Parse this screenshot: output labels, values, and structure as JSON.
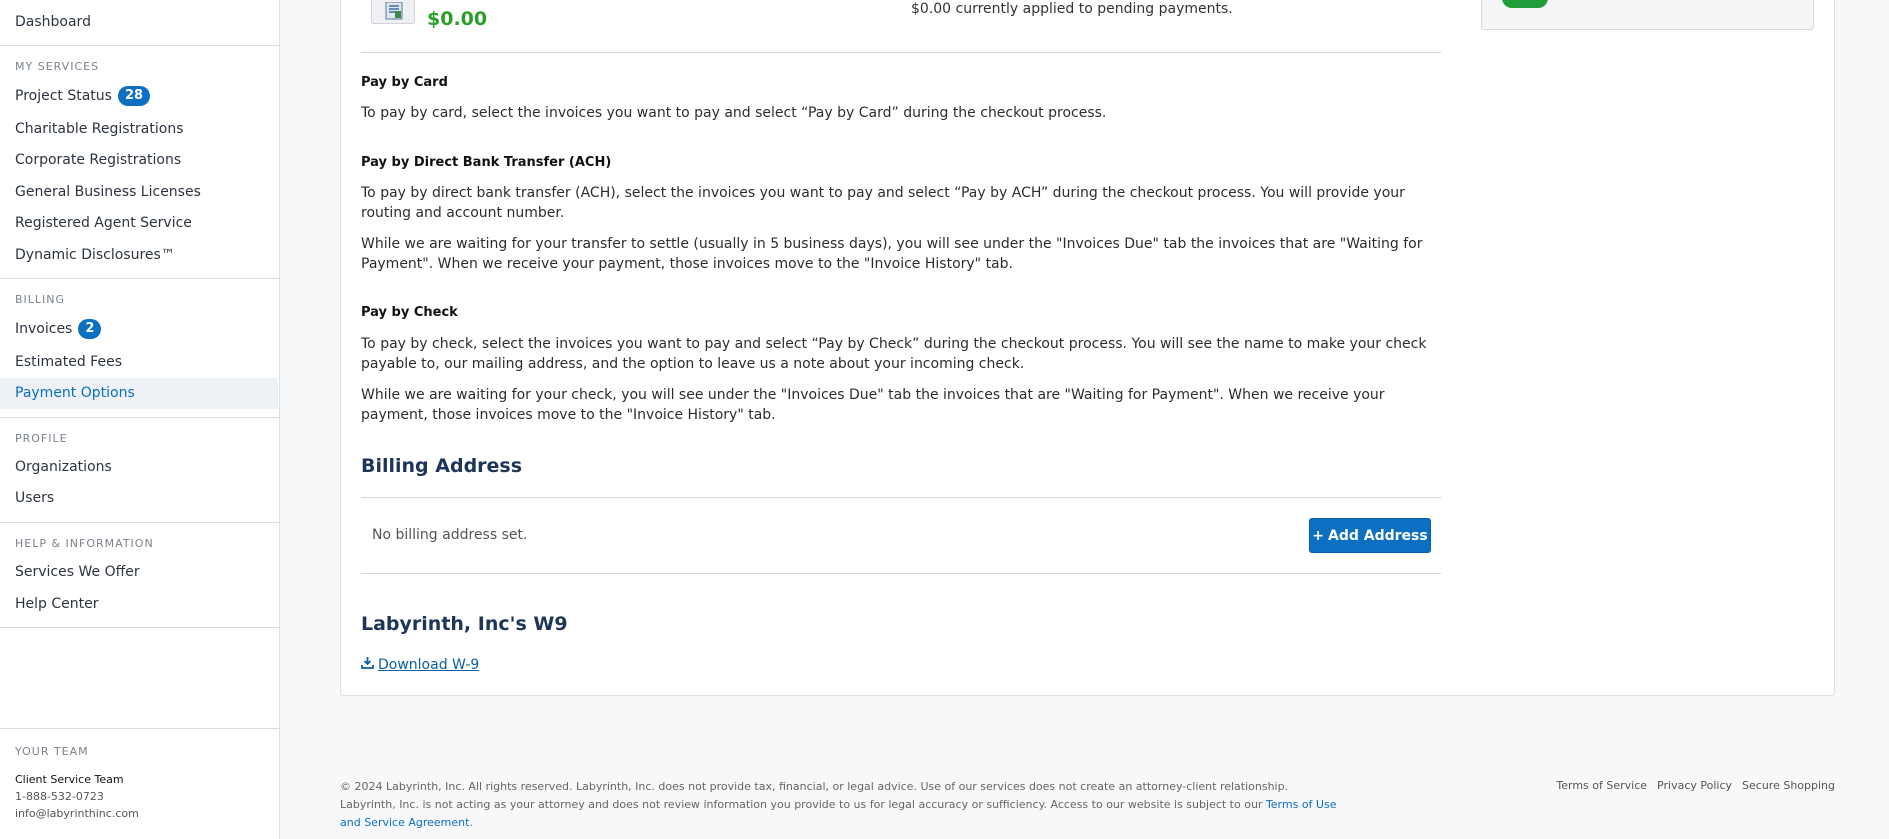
{
  "sidebar": {
    "dashboard": "Dashboard",
    "my_services": {
      "heading": "MY SERVICES",
      "items": [
        {
          "label": "Project Status",
          "badge": "28"
        },
        {
          "label": "Charitable Registrations"
        },
        {
          "label": "Corporate Registrations"
        },
        {
          "label": "General Business Licenses"
        },
        {
          "label": "Registered Agent Service"
        },
        {
          "label": "Dynamic Disclosures™"
        }
      ]
    },
    "billing": {
      "heading": "BILLING",
      "items": [
        {
          "label": "Invoices",
          "badge": "2"
        },
        {
          "label": "Estimated Fees"
        },
        {
          "label": "Payment Options",
          "active": true
        }
      ]
    },
    "profile": {
      "heading": "PROFILE",
      "items": [
        {
          "label": "Organizations"
        },
        {
          "label": "Users"
        }
      ]
    },
    "help": {
      "heading": "HELP & INFORMATION",
      "items": [
        {
          "label": "Services We Offer"
        },
        {
          "label": "Help Center"
        }
      ]
    },
    "team": {
      "heading": "YOUR TEAM",
      "name": "Client Service Team",
      "phone": "1-888-532-0723",
      "email": "info@labyrinthinc.com"
    }
  },
  "main": {
    "credit_amount": "$0.00",
    "pending_text": "$0.00 currently applied to pending payments.",
    "pay_by_card": {
      "title": "Pay by Card",
      "text": "To pay by card, select the invoices you want to pay and select “Pay by Card” during the checkout process."
    },
    "pay_by_ach": {
      "title": "Pay by Direct Bank Transfer (ACH)",
      "text1": "To pay by direct bank transfer (ACH), select the invoices you want to pay and select “Pay by ACH” during the checkout process. You will provide your routing and account number.",
      "text2": "While we are waiting for your transfer to settle (usually in 5 business days), you will see under the \"Invoices Due\" tab the invoices that are \"Waiting for Payment\". When we receive your payment, those invoices move to the \"Invoice History\" tab."
    },
    "pay_by_check": {
      "title": "Pay by Check",
      "text1": "To pay by check, select the invoices you want to pay and select “Pay by Check” during the checkout process. You will see the name to make your check payable to, our mailing address, and the option to leave us a note about your incoming check.",
      "text2": "While we are waiting for your check, you will see under the \"Invoices Due\" tab the invoices that are \"Waiting for Payment\". When we receive your payment, those invoices move to the \"Invoice History\" tab."
    },
    "billing_address": {
      "title": "Billing Address",
      "empty_text": "No billing address set.",
      "add_button": "Add Address"
    },
    "w9": {
      "title": "Labyrinth, Inc's W9",
      "download_link": "Download W-9"
    }
  },
  "footer": {
    "legal_text": "© 2024 Labyrinth, Inc. All rights reserved. Labyrinth, Inc. does not provide tax, financial, or legal advice. Use of our services does not create an attorney-client relationship. Labyrinth, Inc. is not acting as your attorney and does not review information you provide to us for legal accuracy or sufficiency. Access to our website is subject to our",
    "terms_link": "Terms of Use and Service Agreement",
    "links": [
      "Terms of Service",
      "Privacy Policy",
      "Secure Shopping"
    ]
  },
  "colors": {
    "accent": "#0b6fc2",
    "success": "#2a9d2a",
    "heading": "#1d3557"
  }
}
